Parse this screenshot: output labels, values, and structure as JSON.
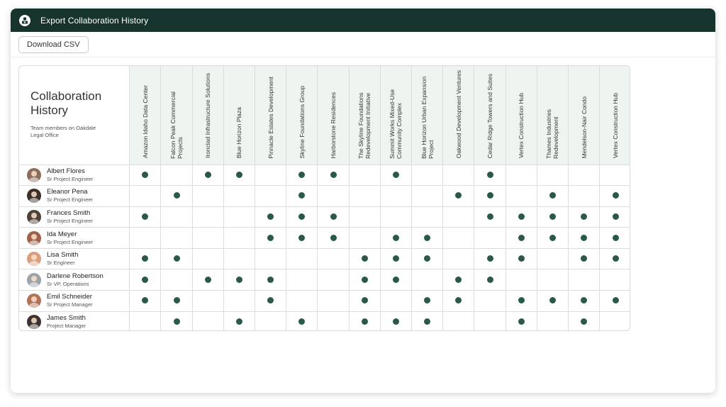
{
  "window": {
    "title": "Export Collaboration History",
    "icon": "export-icon"
  },
  "toolbar": {
    "download_label": "Download CSV"
  },
  "panel": {
    "title": "Collaboration History",
    "subtitle": "Team members on Oakdale Legal Office"
  },
  "colors": {
    "header_bar": "#17332d",
    "dot": "#2a5a46",
    "column_header_bg": "#eef4ef"
  },
  "projects": [
    "Amazon Idaho Data Center",
    "Falcon Peak Commercial Projects",
    "Ironclad Infrastructure Solutions",
    "Blue Horizon Plaza",
    "Pinnacle Estates Development",
    "Skyline Foundations Group",
    "Harborstone Residences",
    "The Skyline Foundations Redevelopment Initiative",
    "Summit Works Mixed-Use Community Complex",
    "Blue Horizon Urban Expansion Project",
    "Oakwood Development Ventures",
    "Cedar Ridge Towers and Suites",
    "Vertex Construction Hub",
    "Thames Industries Redevelopment",
    "Mendelson-Nair Condo",
    "Vertex Construction Hub"
  ],
  "members": [
    {
      "name": "Albert Flores",
      "role": "Sr Project Engineer",
      "avatar_color": "#8a6d5a",
      "collab": [
        1,
        0,
        1,
        1,
        0,
        1,
        1,
        0,
        1,
        0,
        0,
        1,
        0,
        0,
        0,
        0
      ]
    },
    {
      "name": "Eleanor Pena",
      "role": "Sr Project Engineer",
      "avatar_color": "#3b2f2a",
      "collab": [
        0,
        1,
        0,
        0,
        0,
        1,
        0,
        0,
        0,
        0,
        1,
        1,
        0,
        1,
        0,
        1
      ]
    },
    {
      "name": "Frances Smith",
      "role": "Sr Project Engineer",
      "avatar_color": "#4d4238",
      "collab": [
        1,
        0,
        0,
        0,
        1,
        1,
        1,
        0,
        0,
        0,
        0,
        1,
        1,
        1,
        1,
        1
      ]
    },
    {
      "name": "Ida Meyer",
      "role": "Sr Project Engineer",
      "avatar_color": "#a0614a",
      "collab": [
        0,
        0,
        0,
        0,
        1,
        1,
        1,
        0,
        1,
        1,
        0,
        0,
        1,
        1,
        1,
        1
      ]
    },
    {
      "name": "Lisa Smith",
      "role": "Sr Engineer",
      "avatar_color": "#d9a07e",
      "collab": [
        1,
        1,
        0,
        0,
        0,
        0,
        0,
        1,
        1,
        1,
        0,
        1,
        1,
        0,
        1,
        1
      ]
    },
    {
      "name": "Darlene Robertson",
      "role": "Sr VP, Operations",
      "avatar_color": "#9aa3a8",
      "collab": [
        1,
        0,
        1,
        1,
        1,
        0,
        0,
        1,
        1,
        0,
        1,
        1,
        0,
        0,
        0,
        0
      ]
    },
    {
      "name": "Emil Schneider",
      "role": "Sr Project Manager",
      "avatar_color": "#b07358",
      "collab": [
        1,
        1,
        0,
        0,
        1,
        0,
        0,
        1,
        0,
        1,
        1,
        0,
        1,
        1,
        1,
        1
      ]
    },
    {
      "name": "James Smith",
      "role": "Project Manager",
      "avatar_color": "#3a3230",
      "collab": [
        0,
        1,
        0,
        1,
        0,
        1,
        0,
        1,
        1,
        1,
        0,
        0,
        1,
        0,
        1,
        0
      ]
    }
  ]
}
